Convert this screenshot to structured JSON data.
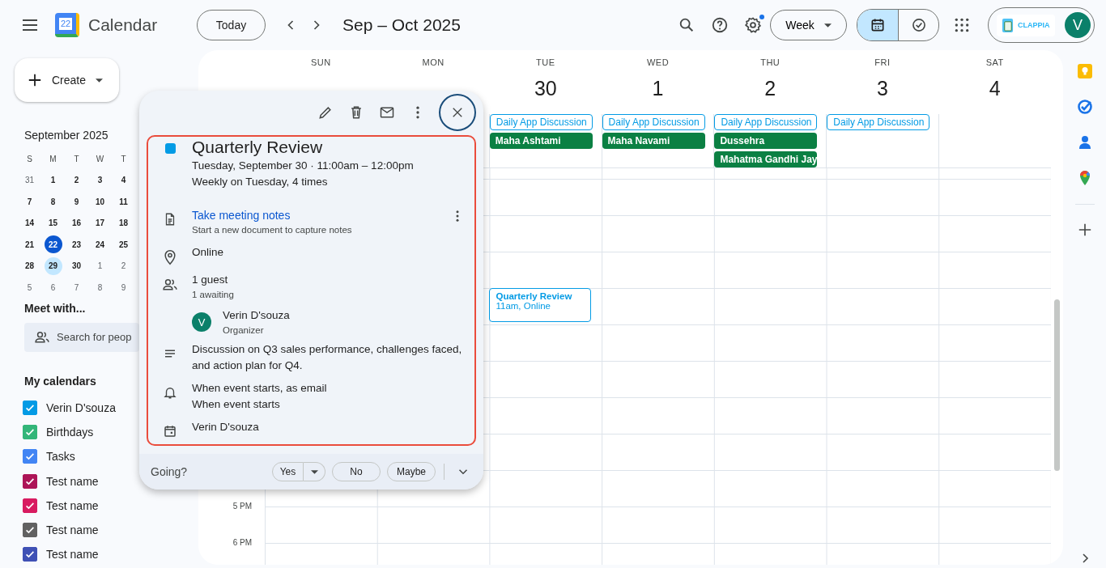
{
  "header": {
    "app_name": "Calendar",
    "logo_day": "22",
    "today_button": "Today",
    "range_title": "Sep – Oct 2025",
    "view_select": "Week",
    "account_brand": "CLAPPIA",
    "avatar_initial": "V",
    "settings_badge": true,
    "view_toggle": [
      {
        "selected": true
      },
      {
        "selected": false
      }
    ]
  },
  "sidebar": {
    "create_label": "Create",
    "mini_calendar": {
      "title": "September 2025",
      "weekdays": [
        "S",
        "M",
        "T",
        "W",
        "T"
      ],
      "weeks": [
        [
          {
            "label": "31",
            "other_month": true,
            "today": false,
            "selected": false
          },
          {
            "label": "1",
            "other_month": false,
            "today": false,
            "selected": false
          },
          {
            "label": "2",
            "other_month": false,
            "today": false,
            "selected": false
          },
          {
            "label": "3",
            "other_month": false,
            "today": false,
            "selected": false
          },
          {
            "label": "4",
            "other_month": false,
            "today": false,
            "selected": false
          }
        ],
        [
          {
            "label": "7",
            "other_month": false,
            "today": false,
            "selected": false
          },
          {
            "label": "8",
            "other_month": false,
            "today": false,
            "selected": false
          },
          {
            "label": "9",
            "other_month": false,
            "today": false,
            "selected": false
          },
          {
            "label": "10",
            "other_month": false,
            "today": false,
            "selected": false
          },
          {
            "label": "11",
            "other_month": false,
            "today": false,
            "selected": false
          }
        ],
        [
          {
            "label": "14",
            "other_month": false,
            "today": false,
            "selected": false
          },
          {
            "label": "15",
            "other_month": false,
            "today": false,
            "selected": false
          },
          {
            "label": "16",
            "other_month": false,
            "today": false,
            "selected": false
          },
          {
            "label": "17",
            "other_month": false,
            "today": false,
            "selected": false
          },
          {
            "label": "18",
            "other_month": false,
            "today": false,
            "selected": false
          }
        ],
        [
          {
            "label": "21",
            "other_month": false,
            "today": false,
            "selected": false
          },
          {
            "label": "22",
            "other_month": false,
            "today": true,
            "selected": false
          },
          {
            "label": "23",
            "other_month": false,
            "today": false,
            "selected": false
          },
          {
            "label": "24",
            "other_month": false,
            "today": false,
            "selected": false
          },
          {
            "label": "25",
            "other_month": false,
            "today": false,
            "selected": false
          }
        ],
        [
          {
            "label": "28",
            "other_month": false,
            "today": false,
            "selected": false
          },
          {
            "label": "29",
            "other_month": false,
            "today": false,
            "selected": true
          },
          {
            "label": "30",
            "other_month": false,
            "today": false,
            "selected": false
          },
          {
            "label": "1",
            "other_month": true,
            "today": false,
            "selected": false
          },
          {
            "label": "2",
            "other_month": true,
            "today": false,
            "selected": false
          }
        ],
        [
          {
            "label": "5",
            "other_month": true,
            "today": false,
            "selected": false
          },
          {
            "label": "6",
            "other_month": true,
            "today": false,
            "selected": false
          },
          {
            "label": "7",
            "other_month": true,
            "today": false,
            "selected": false
          },
          {
            "label": "8",
            "other_month": true,
            "today": false,
            "selected": false
          },
          {
            "label": "9",
            "other_month": true,
            "today": false,
            "selected": false
          }
        ]
      ]
    },
    "meet_title": "Meet with...",
    "people_search": {
      "placeholder": "Search for peop"
    },
    "calendars_title": "My calendars",
    "calendars": [
      {
        "name": "Verin D'souza",
        "color": "#039be5",
        "checked": true
      },
      {
        "name": "Birthdays",
        "color": "#33b679",
        "checked": true
      },
      {
        "name": "Tasks",
        "color": "#4285f4",
        "checked": true
      },
      {
        "name": "Test name",
        "color": "#ad1457",
        "checked": true
      },
      {
        "name": "Test name",
        "color": "#d81b60",
        "checked": true
      },
      {
        "name": "Test name",
        "color": "#616161",
        "checked": true
      },
      {
        "name": "Test name",
        "color": "#3f51b5",
        "checked": true
      }
    ]
  },
  "week": {
    "days": [
      {
        "name": "SUN"
      },
      {
        "name": "MON"
      },
      {
        "name": "TUE",
        "date": "30",
        "all_day": [
          {
            "title": "Daily App Discussion",
            "kind": "outlined"
          },
          {
            "title": "Maha Ashtami",
            "kind": "filled"
          }
        ]
      },
      {
        "name": "WED",
        "date": "1",
        "all_day": [
          {
            "title": "Daily App Discussion",
            "kind": "outlined"
          },
          {
            "title": "Maha Navami",
            "kind": "filled"
          }
        ]
      },
      {
        "name": "THU",
        "date": "2",
        "all_day": [
          {
            "title": "Daily App Discussion",
            "kind": "outlined"
          },
          {
            "title": "Dussehra",
            "kind": "filled"
          },
          {
            "title": "Mahatma Gandhi Jay",
            "kind": "filled"
          }
        ]
      },
      {
        "name": "FRI",
        "date": "3",
        "all_day": [
          {
            "title": "Daily App Discussion",
            "kind": "outlined"
          }
        ]
      },
      {
        "name": "SAT",
        "date": "4"
      }
    ],
    "hour_rows": [
      {},
      {},
      {},
      {},
      {
        "cells": [
          {},
          {},
          {
            "events": [
              {
                "title": "Quarterly Review",
                "detail": "11am, Online"
              }
            ]
          },
          {},
          {},
          {},
          {}
        ]
      },
      {},
      {},
      {},
      {},
      {},
      {
        "label": "5 PM"
      },
      {
        "label": "6 PM"
      }
    ]
  },
  "popup": {
    "color": "#039be5",
    "title": "Quarterly Review",
    "date_line": "Tuesday, September 30  ·  11:00am – 12:00pm",
    "recurrence": "Weekly on Tuesday, 4 times",
    "notes_link": "Take meeting notes",
    "notes_hint": "Start a new document to capture notes",
    "location": "Online",
    "guests_count": "1 guest",
    "guests_status": "1 awaiting",
    "guest": {
      "initial": "V",
      "name": "Verin D'souza",
      "role": "Organizer"
    },
    "description": "Discussion on Q3 sales performance, challenges faced, and action plan for Q4.",
    "reminders": [
      "When event starts, as email",
      "When event starts"
    ],
    "calendar": "Verin D'souza",
    "footer": {
      "prompt": "Going?",
      "responses": [
        {
          "label": "Yes",
          "kind": "split"
        },
        {
          "label": "No",
          "kind": "plain"
        },
        {
          "label": "Maybe",
          "kind": "plain"
        }
      ]
    }
  }
}
